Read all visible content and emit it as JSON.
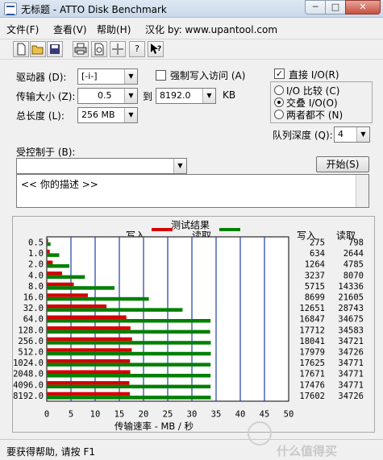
{
  "window": {
    "title": "无标题 - ATTO Disk Benchmark",
    "minimize": "─",
    "maximize": "□",
    "close": "✕"
  },
  "menu": [
    "文件(F)",
    "查看(V)",
    "帮助(H)",
    "汉化 by: www.upantool.com"
  ],
  "toolbar": [
    "new-icon",
    "open-icon",
    "save-icon",
    "print-icon",
    "print-preview-icon",
    "move-icon",
    "help-icon",
    "context-help-icon"
  ],
  "settings": {
    "drive_label": "驱动器 (D):",
    "drive_value": "[-i-]",
    "transfer_size_label": "传输大小 (Z):",
    "transfer_from": "0.5",
    "to_label": "到",
    "transfer_to": "8192.0",
    "unit": "KB",
    "total_length_label": "总长度 (L):",
    "total_length": "256 MB",
    "force_write_label": "强制写入访问 (A)",
    "force_write_checked": false,
    "direct_io_label": "直接 I/O(R)",
    "direct_io_checked": true,
    "io_options": [
      "I/O 比较 (C)",
      "交叠 I/O(O)",
      "两者都不 (N)"
    ],
    "io_selected": 1,
    "queue_depth_label": "队列深度 (Q):",
    "queue_depth": "4",
    "controlled_by_label": "受控制于 (B):",
    "controlled_by": "",
    "start_button": "开始(S)",
    "description": "<<  你的描述  >>"
  },
  "results": {
    "title": "测试结果",
    "write_legend": "写入",
    "read_legend": "读取",
    "write_header": "写入",
    "read_header": "读取",
    "write_color": "#d40000",
    "read_color": "#008000"
  },
  "chart_data": {
    "type": "bar",
    "orientation": "horizontal",
    "title": "测试结果",
    "xlabel": "传输速率 - MB / 秒",
    "xlim": [
      0,
      50
    ],
    "xticks": [
      0,
      5,
      10,
      15,
      20,
      25,
      30,
      35,
      40,
      45,
      50
    ],
    "categories": [
      "0.5",
      "1.0",
      "2.0",
      "4.0",
      "8.0",
      "16.0",
      "32.0",
      "64.0",
      "128.0",
      "256.0",
      "512.0",
      "1024.0",
      "2048.0",
      "4096.0",
      "8192.0"
    ],
    "series": [
      {
        "name": "写入",
        "values": [
          0.27,
          0.62,
          1.23,
          3.16,
          5.58,
          8.5,
          12.35,
          16.45,
          17.3,
          17.62,
          17.56,
          17.21,
          17.26,
          17.07,
          17.19
        ]
      },
      {
        "name": "读取",
        "values": [
          0.78,
          2.58,
          4.67,
          7.88,
          14.0,
          21.1,
          28.07,
          33.86,
          33.77,
          33.91,
          33.91,
          33.86,
          33.86,
          33.86,
          33.91
        ]
      }
    ],
    "write_values_text": [
      "275",
      "634",
      "1264",
      "3237",
      "5715",
      "8699",
      "12651",
      "16847",
      "17712",
      "18041",
      "17979",
      "17625",
      "17671",
      "17476",
      "17602"
    ],
    "read_values_text": [
      "798",
      "2644",
      "4785",
      "8070",
      "14336",
      "21605",
      "28743",
      "34675",
      "34583",
      "34721",
      "34726",
      "34771",
      "34771",
      "34771",
      "34726"
    ]
  },
  "status": "要获得帮助, 请按 F1",
  "watermark": "什么值得买"
}
